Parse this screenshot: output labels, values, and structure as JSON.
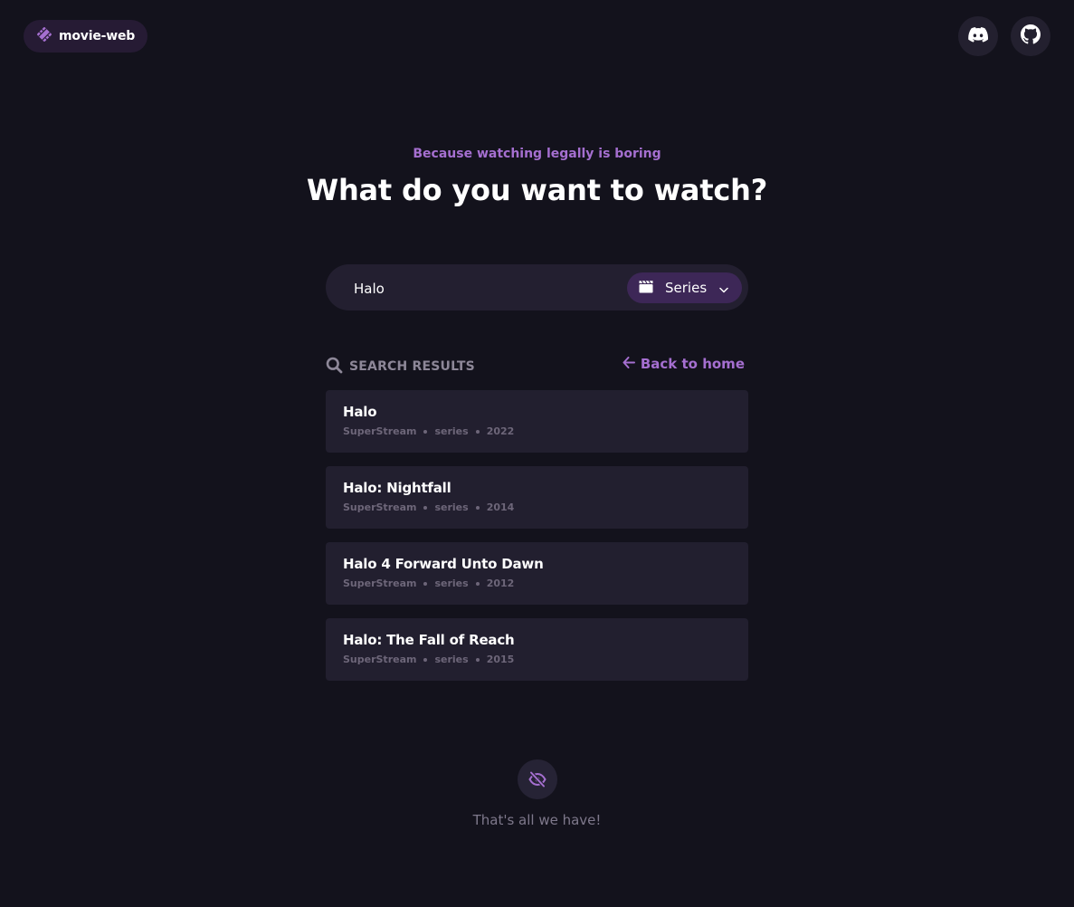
{
  "brand": {
    "name": "movie-web",
    "icon": "film-icon",
    "accent": "#a56fd0"
  },
  "header_links": [
    {
      "name": "discord",
      "icon": "discord-icon"
    },
    {
      "name": "github",
      "icon": "github-icon"
    }
  ],
  "hero": {
    "tagline": "Because watching legally is boring",
    "title": "What do you want to watch?"
  },
  "search": {
    "value": "Halo",
    "type_selected": "Series",
    "type_icon": "clapperboard-icon"
  },
  "results": {
    "heading": "SEARCH RESULTS",
    "back_label": "Back to home",
    "items": [
      {
        "title": "Halo",
        "provider": "SuperStream",
        "type": "series",
        "year": "2022"
      },
      {
        "title": "Halo: Nightfall",
        "provider": "SuperStream",
        "type": "series",
        "year": "2014"
      },
      {
        "title": "Halo 4 Forward Unto Dawn",
        "provider": "SuperStream",
        "type": "series",
        "year": "2012"
      },
      {
        "title": "Halo: The Fall of Reach",
        "provider": "SuperStream",
        "type": "series",
        "year": "2015"
      }
    ]
  },
  "footer": {
    "end_text": "That's all we have!",
    "icon": "eye-slash-icon"
  }
}
